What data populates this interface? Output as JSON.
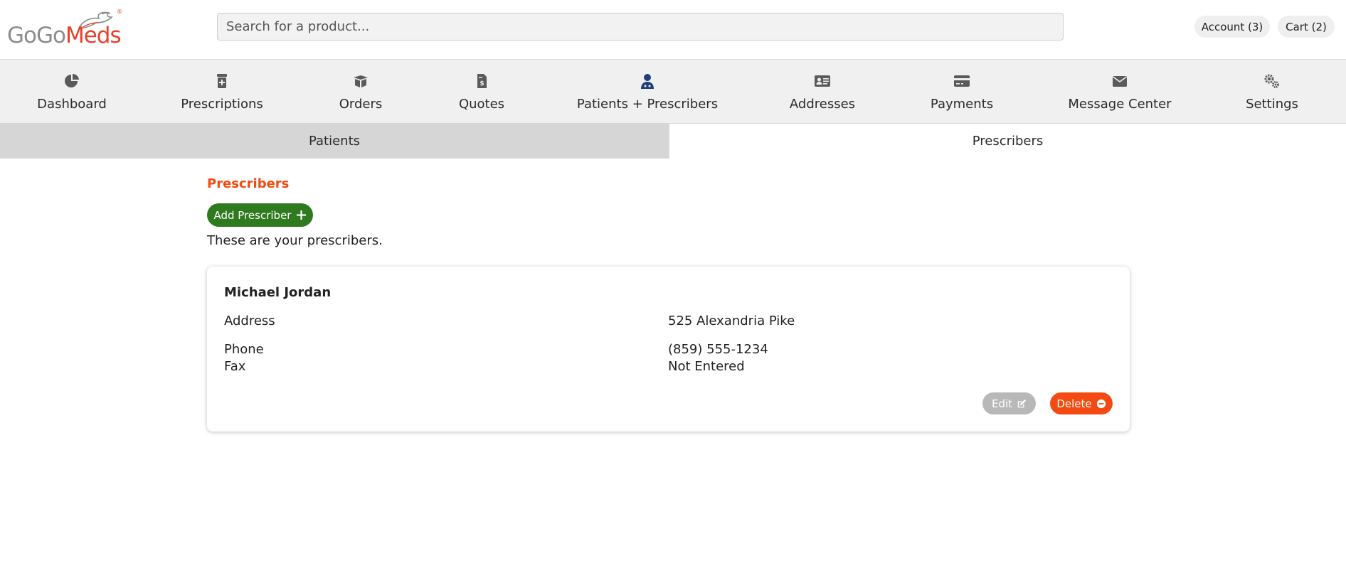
{
  "brand": {
    "go_text": "GoGo",
    "meds_text": "Meds",
    "reg_mark": "®"
  },
  "search": {
    "placeholder": "Search for a product..."
  },
  "header": {
    "account_label": "Account (3)",
    "cart_label": "Cart (2)"
  },
  "nav": {
    "items": [
      {
        "label": "Dashboard",
        "icon": "pie-chart-icon"
      },
      {
        "label": "Prescriptions",
        "icon": "prescription-bottle-icon"
      },
      {
        "label": "Orders",
        "icon": "open-box-icon"
      },
      {
        "label": "Quotes",
        "icon": "invoice-dollar-icon"
      },
      {
        "label": "Patients + Prescribers",
        "icon": "user-doctor-icon"
      },
      {
        "label": "Addresses",
        "icon": "address-card-icon"
      },
      {
        "label": "Payments",
        "icon": "credit-card-icon"
      },
      {
        "label": "Message Center",
        "icon": "envelope-icon"
      },
      {
        "label": "Settings",
        "icon": "gears-icon"
      }
    ],
    "active_index": 4
  },
  "subtabs": {
    "patients": "Patients",
    "prescribers": "Prescribers",
    "active": "Patients"
  },
  "content": {
    "title": "Prescribers",
    "add_button": "Add Prescriber",
    "intro": "These are your prescribers."
  },
  "prescriber": {
    "name": "Michael Jordan",
    "address_label": "Address",
    "address_value": "525 Alexandria Pike",
    "phone_label": "Phone",
    "phone_value": "(859) 555-1234",
    "fax_label": "Fax",
    "fax_value": "Not Entered",
    "edit_label": "Edit",
    "delete_label": "Delete"
  },
  "colors": {
    "accent_orange": "#f24a12",
    "green": "#2f7a1f",
    "nav_icon": "#5a5a5a",
    "nav_icon_active": "#1f3f7a",
    "disabled_gray": "#b8b8b8"
  }
}
